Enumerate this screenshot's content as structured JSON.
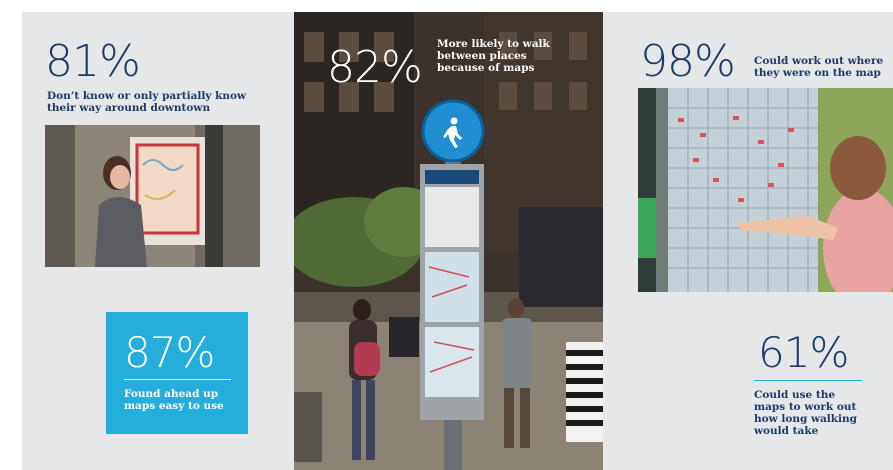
{
  "colors": {
    "navy": "#1d3a66",
    "accent": "#25aedc",
    "panel": "#e6e7e9"
  },
  "stats": {
    "s81": {
      "value": "81%",
      "caption": "Don’t know or only partially know their way around downtown"
    },
    "s82": {
      "value": "82%",
      "caption": "More likely to walk between places because of maps"
    },
    "s98": {
      "value": "98%",
      "caption": "Could work out where they were on the map"
    },
    "s87": {
      "value": "87%",
      "caption": "Found ahead up maps easy to use"
    },
    "s61": {
      "value": "61%",
      "caption": "Could use the maps to work out how long walking would take"
    }
  },
  "icons": {
    "walk": "pedestrian-icon"
  }
}
